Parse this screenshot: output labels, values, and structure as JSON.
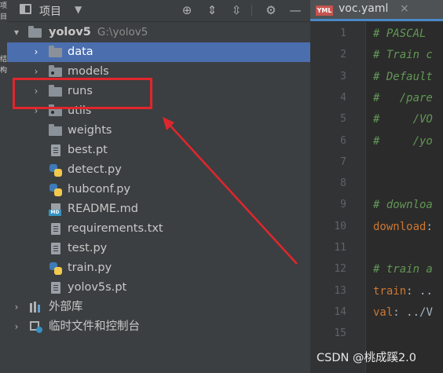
{
  "tool_strip": {
    "glyphs": [
      "项",
      "目",
      "结",
      "构"
    ]
  },
  "project_panel": {
    "title": "项目",
    "dropdown_icon": "triangle-down",
    "tools": [
      "locate-icon",
      "expand-all-icon",
      "collapse-all-icon",
      "settings-icon",
      "hide-icon"
    ]
  },
  "tree": {
    "root": {
      "name": "yolov5",
      "path": "G:\\yolov5"
    },
    "folders": [
      "data",
      "models",
      "runs",
      "utils",
      "weights"
    ],
    "files": [
      "best.pt",
      "detect.py",
      "hubconf.py",
      "README.md",
      "requirements.txt",
      "test.py",
      "train.py",
      "yolov5s.pt"
    ],
    "extra": [
      "外部库",
      "临时文件和控制台"
    ],
    "md_tag": "MD"
  },
  "editor": {
    "tab": {
      "label": "voc.yaml",
      "icon_text": "YML",
      "close": "×"
    },
    "line_numbers": [
      "1",
      "2",
      "3",
      "4",
      "5",
      "6",
      "7",
      "8",
      "9",
      "10",
      "11",
      "12",
      "13",
      "14",
      "15"
    ],
    "lines": [
      {
        "comment": "# PASCAL"
      },
      {
        "comment": "# Train c"
      },
      {
        "comment": "# Default"
      },
      {
        "comment": "#   /pare"
      },
      {
        "comment": "#     /VO"
      },
      {
        "comment": "#     /yo"
      },
      {
        "comment": ""
      },
      {
        "comment": ""
      },
      {
        "comment": "# downloa"
      },
      {
        "key": "download",
        "rest": ":"
      },
      {
        "comment": ""
      },
      {
        "comment": "# train a"
      },
      {
        "key": "train",
        "rest": ": .."
      },
      {
        "key": "val",
        "rest": ": ../V"
      },
      {
        "comment": ""
      }
    ]
  },
  "watermark": "CSDN @桃成蹊2.0",
  "colors": {
    "selection": "#4b6eaf",
    "highlight": "#e0262d",
    "comment": "#629755",
    "key": "#cc7832"
  }
}
